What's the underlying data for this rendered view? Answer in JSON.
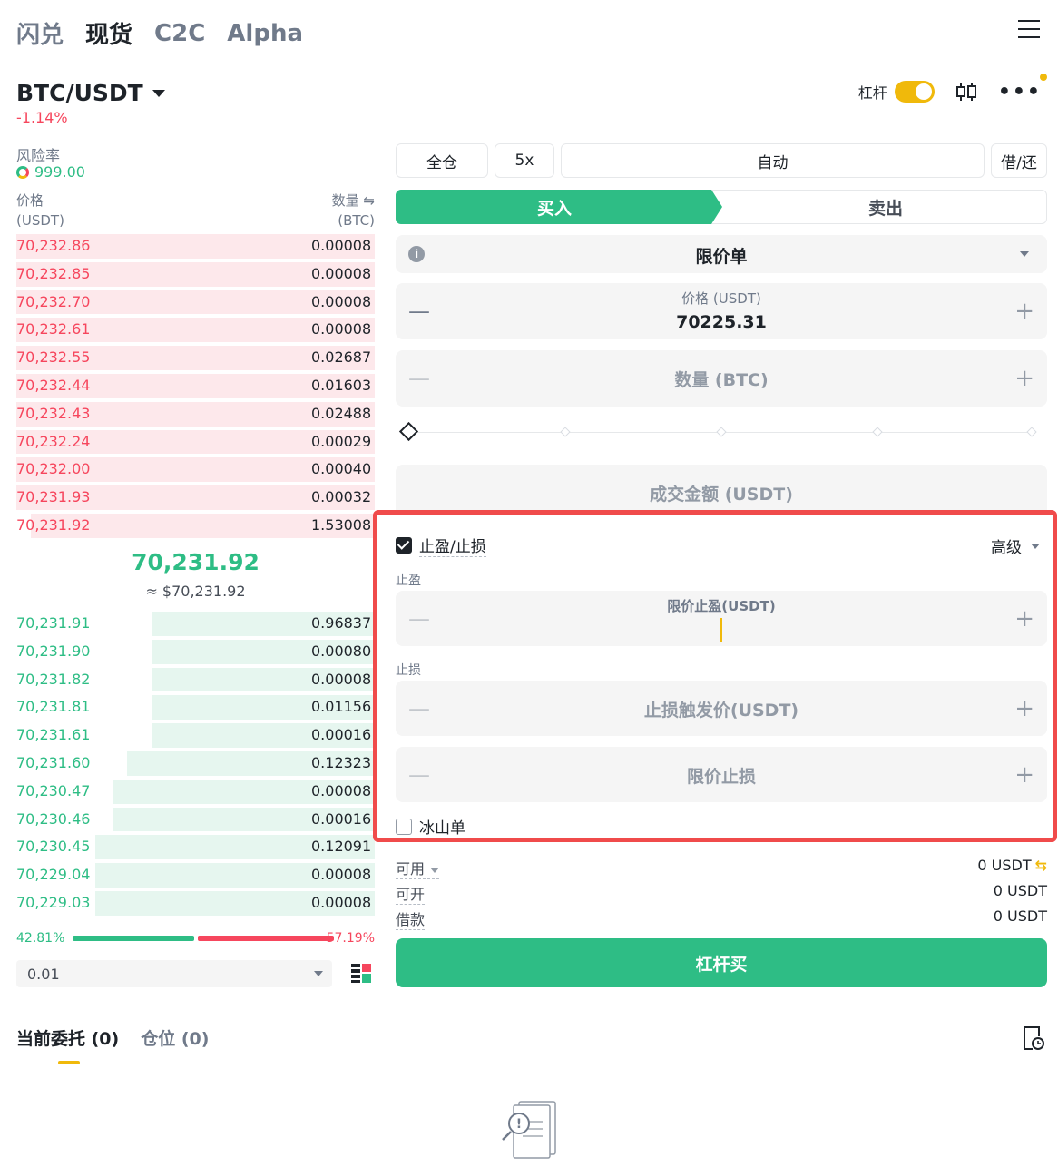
{
  "top_nav": {
    "tabs": [
      "闪兑",
      "现货",
      "C2C",
      "Alpha"
    ],
    "active": "现货"
  },
  "pair": {
    "name": "BTC/USDT",
    "change": "-1.14%"
  },
  "header_right": {
    "leverage_label": "杠杆",
    "leverage_on": true
  },
  "risk": {
    "label": "风险率",
    "value": "999.00"
  },
  "orderbook": {
    "price_header": "价格",
    "price_unit": "(USDT)",
    "qty_header": "数量 ⇋",
    "qty_unit": "(BTC)",
    "asks": [
      {
        "price": "70,232.86",
        "qty": "0.00008",
        "depth": 1.0
      },
      {
        "price": "70,232.85",
        "qty": "0.00008",
        "depth": 1.0
      },
      {
        "price": "70,232.70",
        "qty": "0.00008",
        "depth": 1.0
      },
      {
        "price": "70,232.61",
        "qty": "0.00008",
        "depth": 1.0
      },
      {
        "price": "70,232.55",
        "qty": "0.02687",
        "depth": 1.0
      },
      {
        "price": "70,232.44",
        "qty": "0.01603",
        "depth": 1.0
      },
      {
        "price": "70,232.43",
        "qty": "0.02488",
        "depth": 1.0
      },
      {
        "price": "70,232.24",
        "qty": "0.00029",
        "depth": 1.0
      },
      {
        "price": "70,232.00",
        "qty": "0.00040",
        "depth": 1.0
      },
      {
        "price": "70,231.93",
        "qty": "0.00032",
        "depth": 1.0
      },
      {
        "price": "70,231.92",
        "qty": "1.53008",
        "depth": 0.96
      }
    ],
    "mid_price": "70,231.92",
    "mid_fiat": "≈ $70,231.92",
    "bids": [
      {
        "price": "70,231.91",
        "qty": "0.96837",
        "depth": 0.62
      },
      {
        "price": "70,231.90",
        "qty": "0.00080",
        "depth": 0.62
      },
      {
        "price": "70,231.82",
        "qty": "0.00008",
        "depth": 0.62
      },
      {
        "price": "70,231.81",
        "qty": "0.01156",
        "depth": 0.62
      },
      {
        "price": "70,231.61",
        "qty": "0.00016",
        "depth": 0.62
      },
      {
        "price": "70,231.60",
        "qty": "0.12323",
        "depth": 0.69
      },
      {
        "price": "70,230.47",
        "qty": "0.00008",
        "depth": 0.73
      },
      {
        "price": "70,230.46",
        "qty": "0.00016",
        "depth": 0.73
      },
      {
        "price": "70,230.45",
        "qty": "0.12091",
        "depth": 0.78
      },
      {
        "price": "70,229.04",
        "qty": "0.00008",
        "depth": 0.78
      },
      {
        "price": "70,229.03",
        "qty": "0.00008",
        "depth": 0.78
      }
    ],
    "buy_ratio": "42.81%",
    "sell_ratio": "57.19%",
    "precision": "0.01"
  },
  "trade": {
    "margin_mode": "全仓",
    "leverage": "5x",
    "borrow_mode": "自动",
    "borrow_repay": "借/还",
    "buy_tab": "买入",
    "sell_tab": "卖出",
    "order_type": "限价单",
    "price_label": "价格 (USDT)",
    "price_value": "70225.31",
    "qty_placeholder": "数量 (BTC)",
    "total_placeholder": "成交金额 (USDT)",
    "tpsl_label": "止盈/止损",
    "tpsl_checked": true,
    "advanced": "高级",
    "tp_section": "止盈",
    "tp_limit_label": "限价止盈(USDT)",
    "sl_section": "止损",
    "sl_trigger_placeholder": "止损触发价(USDT)",
    "sl_limit_placeholder": "限价止损",
    "iceberg_label": "冰山单",
    "iceberg_checked": false,
    "available_label": "可用",
    "available_value": "0 USDT",
    "openable_label": "可开",
    "openable_value": "0 USDT",
    "loan_label": "借款",
    "loan_value": "0 USDT",
    "submit_label": "杠杆买"
  },
  "bottom_tabs": {
    "open_orders": "当前委托 (0)",
    "positions": "仓位 (0)"
  },
  "colors": {
    "buy": "#2ebd85",
    "sell": "#f6465d",
    "accent": "#f0b90b",
    "highlight": "#f04b4b"
  }
}
